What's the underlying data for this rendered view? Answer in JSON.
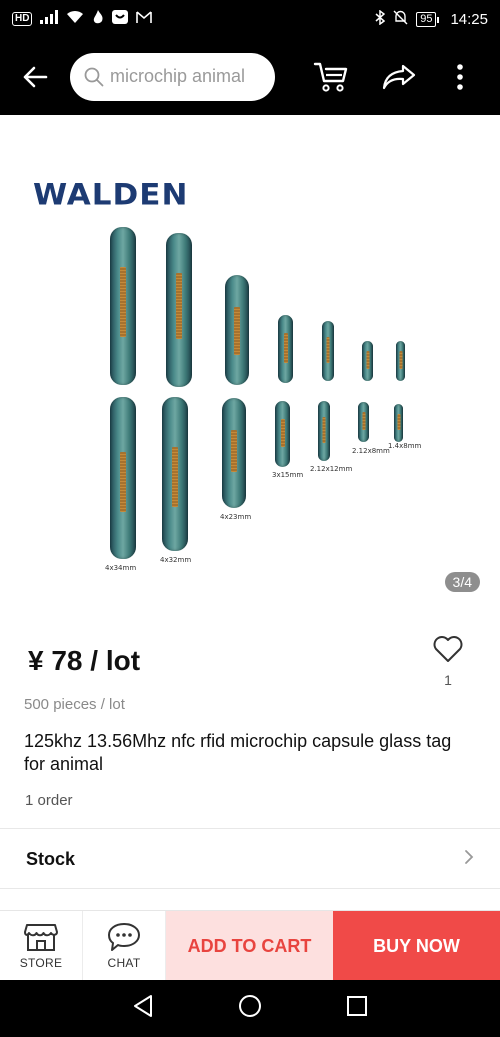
{
  "status_bar": {
    "hd": "HD",
    "battery": "95",
    "time": "14:25"
  },
  "header": {
    "search_placeholder": "microchip animal",
    "icons": [
      "back-arrow-icon",
      "search-icon",
      "cart-icon",
      "share-icon",
      "more-vertical-icon"
    ]
  },
  "gallery": {
    "brand": "WALDEN",
    "page_indicator": "3/4",
    "size_labels": [
      "4x34mm",
      "4x32mm",
      "4x23mm",
      "3x15mm",
      "2.12x12mm",
      "2.12x8mm",
      "1.4x8mm"
    ]
  },
  "product": {
    "price": "¥ 78 / lot",
    "wish_count": "1",
    "unit_info": "500 pieces / lot",
    "title": "125khz 13.56Mhz nfc rfid microchip capsule glass tag for animal",
    "orders": "1 order"
  },
  "stock": {
    "label": "Stock"
  },
  "action_bar": {
    "store_label": "STORE",
    "chat_label": "CHAT",
    "add_to_cart": "ADD TO CART",
    "buy_now": "BUY NOW"
  },
  "colors": {
    "accent_red": "#f04a48",
    "accent_light": "#fde0df",
    "brand_blue": "#1d3b73"
  }
}
